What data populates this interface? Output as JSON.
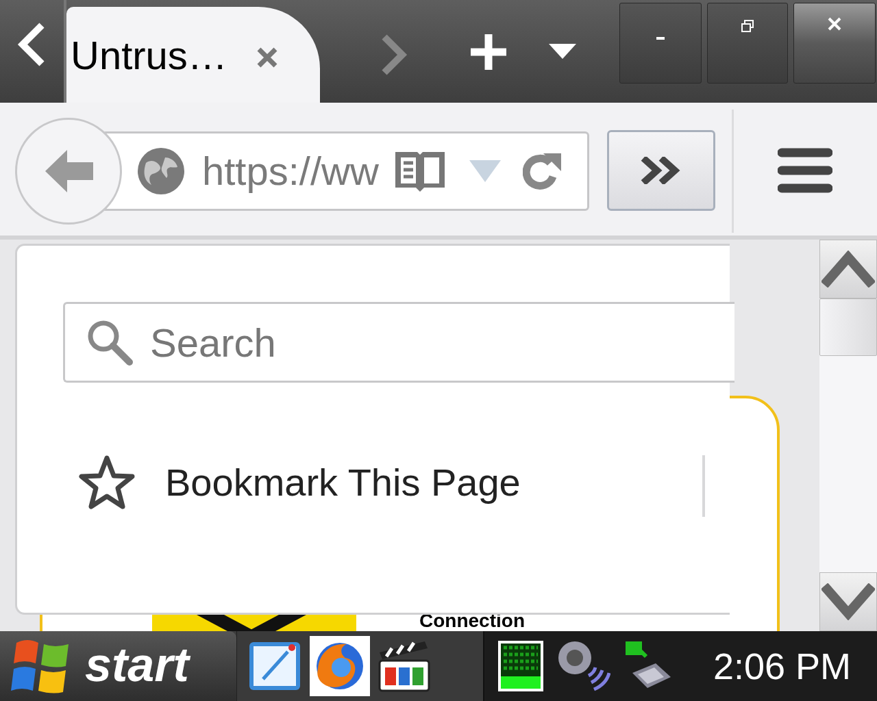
{
  "tabs": [
    {
      "title": "Untrus…",
      "selected": true
    }
  ],
  "address_bar": {
    "url": "https://ww"
  },
  "menu_panel": {
    "search": {
      "placeholder": "Search"
    },
    "items": [
      {
        "label": "Bookmark This Page"
      }
    ]
  },
  "page": {
    "heading": "Connection"
  },
  "taskbar": {
    "start": "start",
    "clock": "2:06 PM"
  }
}
